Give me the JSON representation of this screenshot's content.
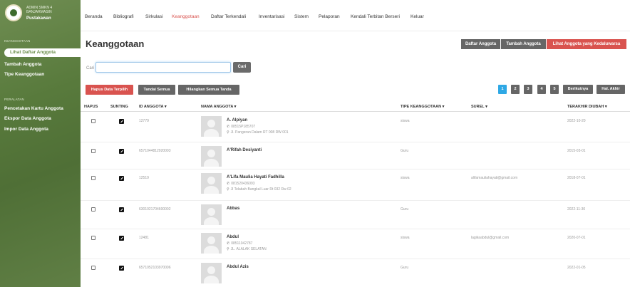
{
  "app": {
    "brand_name": "ADMIN SMKN 4 BANJARMASIN",
    "brand_role": "Pustakawan"
  },
  "nav": [
    "Beranda",
    "Bibliografi",
    "Sirkulasi",
    "Keanggotaan",
    "Daftar Terkendali",
    "Inventarisasi",
    "Sistem",
    "Pelaporan",
    "Kendali Terbitan Berseri",
    "Keluar"
  ],
  "nav_active": "Keanggotaan",
  "sidebar": {
    "section1": "KEANGGOTAAN",
    "items1": [
      "Lihat Daftar Anggota",
      "Tambah Anggota",
      "Tipe Keanggotaan"
    ],
    "section2": "PERALATAN",
    "items2": [
      "Pencetakan Kartu Anggota",
      "Ekspor Data Anggota",
      "Impor Data Anggota"
    ]
  },
  "page_title": "Keanggotaan",
  "header_buttons": [
    "Daftar Anggota",
    "Tambah Anggota",
    "Lihat Anggota yang Kedaluwarsa"
  ],
  "search": {
    "label": "Cari",
    "value": "",
    "button": "Cari"
  },
  "actions": [
    "Hapus Data Terpilih",
    "Tandai Semua",
    "Hilangkan Semua Tanda"
  ],
  "pagination": [
    "1",
    "2",
    "3",
    "4",
    "5",
    "Berikutnya",
    "Hal. Akhir"
  ],
  "columns": [
    "HAPUS",
    "SUNTING",
    "ID ANGGOTA ▾",
    "NAMA ANGGOTA ▾",
    "TIPE KEANGGOTAAN ▾",
    "SUREL ▾",
    "TERAKHIR DIUBAH ▾"
  ],
  "rows": [
    {
      "id": "12779",
      "name": "A. Alpiyan",
      "phone": "08515P185707",
      "address": "Jl. Pangeran Dalam RT 008 RW 001",
      "type": "siswa",
      "email": "",
      "updated": "2022-10-20"
    },
    {
      "id": "6571044812920003",
      "name": "A'Rifah Desiyanti",
      "phone": "",
      "address": "",
      "type": "Guru",
      "email": "",
      "updated": "2015-03-01"
    },
    {
      "id": "12519",
      "name": "A'Lifa Maulia Hayati Fadhilla",
      "phone": "081520436093",
      "address": "Jl Telabah Bangkal Luar Rt 032 Rw 02",
      "type": "siswa",
      "email": "alifamauliahayati@gmail.com",
      "updated": "2018-07-01"
    },
    {
      "id": "6301021704600002",
      "name": "Abbas",
      "phone": "",
      "address": "",
      "type": "Guru",
      "email": "",
      "updated": "2022-11-30"
    },
    {
      "id": "12481",
      "name": "Abdul",
      "phone": "08511042787",
      "address": "JL. ALALAK SELATAN",
      "type": "siswa",
      "email": "lagikaabdul@gmail.com",
      "updated": "2020-07-01"
    },
    {
      "id": "6571052103970006",
      "name": "Abdul Azis",
      "phone": "",
      "address": "",
      "type": "Guru",
      "email": "",
      "updated": "2022-01-05"
    }
  ],
  "colors": {
    "accent_red": "#d9534f",
    "active_page": "#2ea8e5",
    "sidebar_green": "#587a3c",
    "grey_button": "#666666"
  }
}
